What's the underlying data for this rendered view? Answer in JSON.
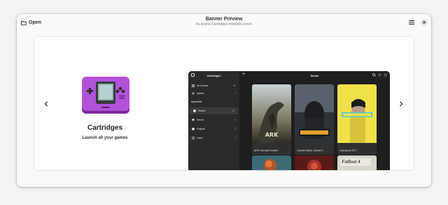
{
  "header": {
    "open_label": "Open",
    "title": "Banner Preview",
    "subtitle": "hu.kramo.Cartridges.metainfo.xml.in"
  },
  "banner": {
    "app_name": "Cartridges",
    "tagline": "Launch all your games"
  },
  "screenshot": {
    "sidebar_title": "Cartridges",
    "main_title": "Steam",
    "sidebar_items": [
      {
        "label": "All Games",
        "count": "22"
      },
      {
        "label": "Added",
        "count": "7"
      }
    ],
    "section_label": "Imported",
    "import_items": [
      {
        "label": "Steam",
        "count": "15"
      },
      {
        "label": "Heroic",
        "count": "6"
      },
      {
        "label": "Flatpak",
        "count": "3"
      },
      {
        "label": "Lutris",
        "count": "1"
      }
    ],
    "games": [
      {
        "name": "ARK: Survival Evolved"
      },
      {
        "name": "Counter-Strike: Global O..."
      },
      {
        "name": "Cyberpunk 2077"
      }
    ],
    "fallout_text": "Fallout 4"
  },
  "colors": {
    "accent": "#a03ec8",
    "window_bg": "#fafafa",
    "card_bg": "#ffffff",
    "dark_bg": "#1e1e1e"
  },
  "icons": {
    "open": "folder-open-icon",
    "menu": "hamburger-menu-icon",
    "close": "close-icon",
    "prev": "chevron-left-icon",
    "next": "chevron-right-icon",
    "app": "handheld-console-icon"
  }
}
